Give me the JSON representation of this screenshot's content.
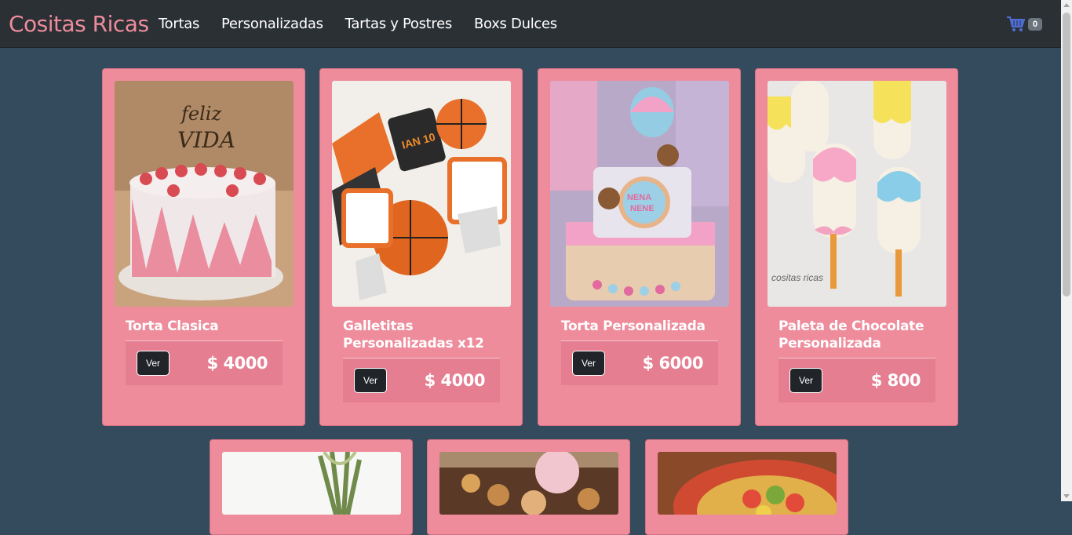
{
  "navbar": {
    "brand": "Cositas Ricas",
    "links": [
      "Tortas",
      "Personalizadas",
      "Tartas y Postres",
      "Boxs Dulces"
    ],
    "cart_count": "0",
    "cart_icon": "cart-icon"
  },
  "products": [
    {
      "title": "Torta Clasica",
      "button": "Ver",
      "price": "$ 4000"
    },
    {
      "title": "Galletitas Personalizadas x12",
      "button": "Ver",
      "price": "$ 4000"
    },
    {
      "title": "Torta Personalizada",
      "button": "Ver",
      "price": "$ 6000"
    },
    {
      "title": "Paleta de Chocolate Personalizada",
      "button": "Ver",
      "price": "$ 800"
    }
  ],
  "colors": {
    "background": "#344b5d",
    "navbar": "#2b3035",
    "brand": "#ee8c9c",
    "card": "#ee8c9c",
    "button": "#212529"
  }
}
